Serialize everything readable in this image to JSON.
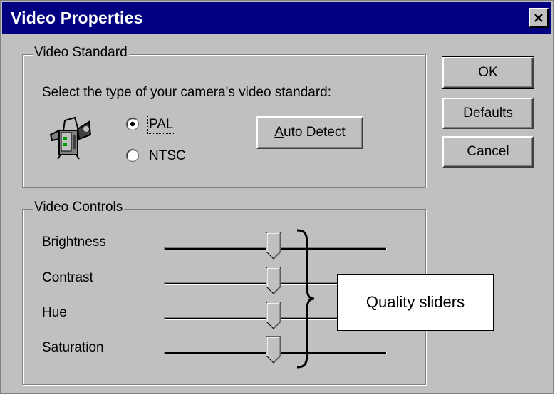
{
  "window": {
    "title": "Video Properties"
  },
  "video_standard": {
    "group_label": "Video Standard",
    "prompt": "Select the type of your camera's video standard:",
    "camera_icon": "camera-icon",
    "options": [
      {
        "label": "PAL",
        "selected": true
      },
      {
        "label": "NTSC",
        "selected": false
      }
    ],
    "auto_detect_label_pre": "",
    "auto_detect_mnemonic": "A",
    "auto_detect_label_post": "uto Detect"
  },
  "buttons": {
    "ok": "OK",
    "defaults_mnemonic": "D",
    "defaults_post": "efaults",
    "cancel": "Cancel"
  },
  "video_controls": {
    "group_label": "Video Controls",
    "sliders": [
      {
        "label": "Brightness",
        "value": 0.49
      },
      {
        "label": "Contrast",
        "value": 0.49
      },
      {
        "label": "Hue",
        "value": 0.49
      },
      {
        "label": "Saturation",
        "value": 0.49
      }
    ]
  },
  "annotation": {
    "callout_text": "Quality sliders"
  }
}
